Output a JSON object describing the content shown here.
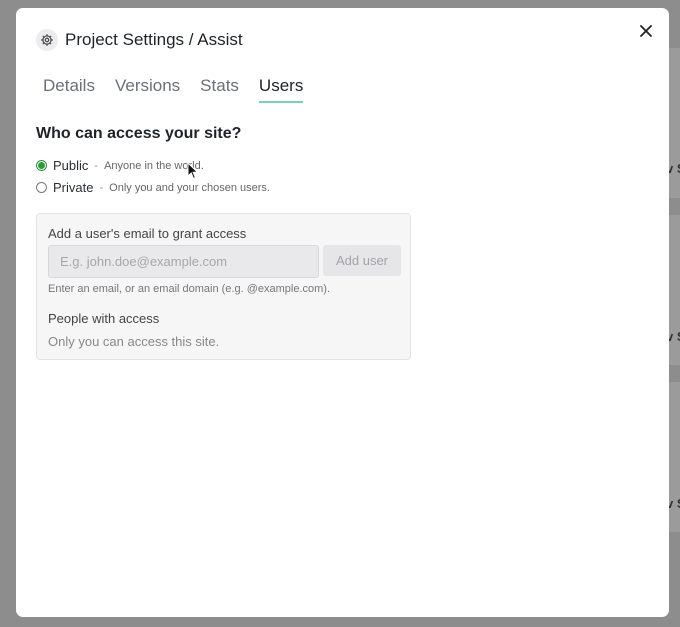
{
  "backdrop": {
    "card_peek_texts": [
      "v S",
      "v S",
      "v S"
    ]
  },
  "modal": {
    "title": "Project Settings / Assist",
    "icons": {
      "settings": "gear-icon",
      "close": "close-icon"
    }
  },
  "tabs": [
    {
      "label": "Details",
      "active": false
    },
    {
      "label": "Versions",
      "active": false
    },
    {
      "label": "Stats",
      "active": false
    },
    {
      "label": "Users",
      "active": true
    }
  ],
  "access": {
    "heading": "Who can access your site?",
    "options": [
      {
        "label": "Public",
        "separator": "-",
        "description": "Anyone in the world.",
        "checked": true
      },
      {
        "label": "Private",
        "separator": "-",
        "description": "Only you and your chosen users.",
        "checked": false
      }
    ]
  },
  "grant": {
    "label": "Add a user's email to grant access",
    "email_placeholder": "E.g. john.doe@example.com",
    "email_value": "",
    "add_button": "Add user",
    "hint": "Enter an email, or an email domain (e.g. @example.com).",
    "people_label": "People with access",
    "people_empty": "Only you can access this site."
  },
  "colors": {
    "tab_underline": "#7ad3b0",
    "radio_checked": "#2f9a3c"
  }
}
